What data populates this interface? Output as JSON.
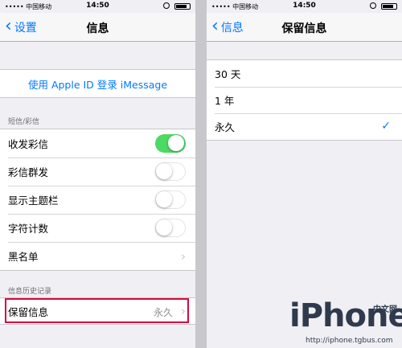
{
  "status_bar": {
    "carrier": "••••• 中国移动",
    "time": "14:50"
  },
  "left": {
    "nav": {
      "back_label": "设置",
      "title": "信息"
    },
    "imessage_link": "使用 Apple ID 登录 iMessage",
    "sms_section": {
      "header": "短信/彩信",
      "rows": [
        {
          "label": "收发彩信",
          "toggle_on": true
        },
        {
          "label": "彩信群发",
          "toggle_on": false
        },
        {
          "label": "显示主题栏",
          "toggle_on": false
        },
        {
          "label": "字符计数",
          "toggle_on": false
        }
      ],
      "blacklist_label": "黑名单"
    },
    "history_section": {
      "header": "信息历史记录",
      "keep_label": "保留信息",
      "keep_value": "永久"
    }
  },
  "right": {
    "nav": {
      "back_label": "信息",
      "title": "保留信息"
    },
    "options": [
      {
        "label": "30 天",
        "selected": false
      },
      {
        "label": "1 年",
        "selected": false
      },
      {
        "label": "永久",
        "selected": true
      }
    ]
  },
  "watermark": {
    "logo_text": "iPhone",
    "cn": "中文网",
    "url": "http://iphone.tgbus.com"
  },
  "colors": {
    "accent": "#007aff",
    "toggle_on": "#4cd964",
    "highlight": "#d40b3c"
  },
  "icons": {
    "back": "chevron-left-icon",
    "disclosure": "chevron-right-icon",
    "selected": "checkmark-icon"
  }
}
